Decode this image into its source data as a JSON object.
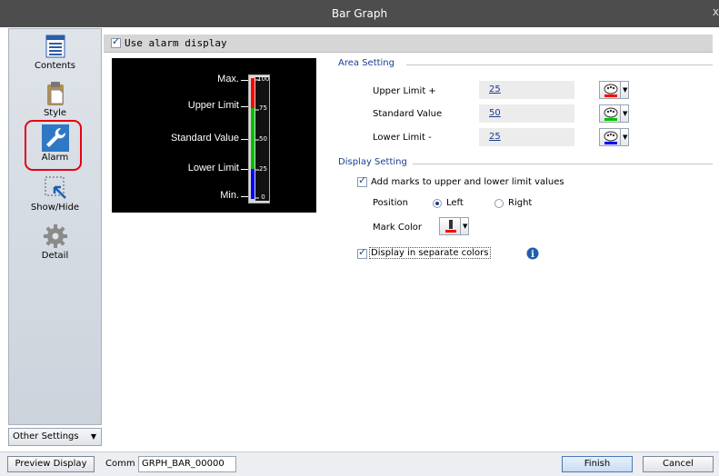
{
  "window": {
    "title": "Bar Graph",
    "close_label": "x"
  },
  "sidebar": {
    "items": [
      {
        "label": "Contents",
        "icon": "contents-icon"
      },
      {
        "label": "Style",
        "icon": "style-icon"
      },
      {
        "label": "Alarm",
        "icon": "wrench-icon",
        "selected": true
      },
      {
        "label": "Show/Hide",
        "icon": "show-hide-icon"
      },
      {
        "label": "Detail",
        "icon": "gear-icon"
      }
    ],
    "other_settings_label": "Other Settings"
  },
  "header": {
    "use_alarm_label": "Use alarm display",
    "checked": true
  },
  "preview": {
    "labels": [
      "Max.",
      "Upper Limit",
      "Standard Value",
      "Lower Limit",
      "Min."
    ],
    "scale": [
      "100",
      "75",
      "50",
      "25",
      "0"
    ]
  },
  "area_setting": {
    "title": "Area Setting",
    "rows": [
      {
        "label": "Upper Limit +",
        "value": "25",
        "color": "#ff0000"
      },
      {
        "label": "Standard Value",
        "value": "50",
        "color": "#00c000"
      },
      {
        "label": "Lower Limit -",
        "value": "25",
        "color": "#0000ff"
      }
    ]
  },
  "display_setting": {
    "title": "Display Setting",
    "add_marks_label": "Add marks to upper and lower limit values",
    "add_marks_checked": true,
    "position_label": "Position",
    "left_label": "Left",
    "right_label": "Right",
    "selected_position": "Left",
    "mark_color_label": "Mark Color",
    "mark_color": "#ff0000",
    "separate_colors_label": "Display in separate colors",
    "separate_colors_checked": true
  },
  "footer": {
    "preview_display_label": "Preview Display",
    "comm_label": "Comm",
    "comm_value": "GRPH_BAR_00000",
    "finish_label": "Finish",
    "cancel_label": "Cancel"
  }
}
